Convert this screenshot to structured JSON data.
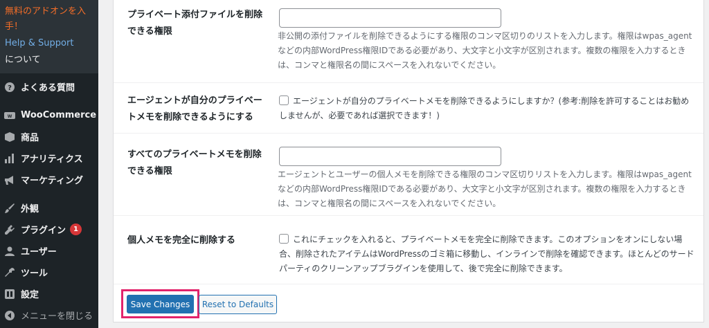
{
  "sidebar": {
    "submenu": {
      "promo": "無料のアドオンを入手！",
      "help": "Help & Support",
      "about": "について"
    },
    "items": [
      {
        "label": "よくある質問",
        "icon": "question-circle-icon"
      },
      {
        "label": "WooCommerce",
        "icon": "woocommerce-icon"
      },
      {
        "label": "商品",
        "icon": "archive-box-icon"
      },
      {
        "label": "アナリティクス",
        "icon": "bar-chart-icon"
      },
      {
        "label": "マーケティング",
        "icon": "megaphone-icon"
      },
      {
        "label": "外観",
        "icon": "paintbrush-icon"
      },
      {
        "label": "プラグイン",
        "icon": "plugin-icon",
        "badge": "1"
      },
      {
        "label": "ユーザー",
        "icon": "user-icon"
      },
      {
        "label": "ツール",
        "icon": "wrench-icon"
      },
      {
        "label": "設定",
        "icon": "settings-icon"
      },
      {
        "label": "メニューを閉じる",
        "icon": "collapse-arrow-icon"
      }
    ]
  },
  "settings": {
    "row1": {
      "label": "プライベート添付ファイルを削除できる権限",
      "description": "非公開の添付ファイルを削除できるようにする権限のコンマ区切りのリストを入力します。権限はwpas_agentなどの内部WordPress権限IDである必要があり、大文字と小文字が区別されます。複数の権限を入力するときは、コンマと権限名の間にスペースを入れないでください。"
    },
    "row2": {
      "label": "エージェントが自分のプライベートメモを削除できるようにする",
      "checkbox_label": "エージェントが自分のプライベートメモを削除できるようにしますか？(参考:削除を許可することはお勧めしませんが、必要であれば選択できます！)"
    },
    "row3": {
      "label": "すべてのプライベートメモを削除できる権限",
      "description": "エージェントとユーザーの個人メモを削除できる権限のコンマ区切りリストを入力します。権限はwpas_agentなどの内部WordPress権限IDである必要があり、大文字と小文字が区別されます。複数の権限を入力するときは、コンマと権限名の間にスペースを入れないでください。"
    },
    "row4": {
      "label": "個人メモを完全に削除する",
      "checkbox_label": "これにチェックを入れると、プライベートメモを完全に削除できます。このオプションをオンにしない場合、削除されたアイテムはWordPressのゴミ箱に移動し、インラインで削除を確認できます。ほとんどのサードパーティのクリーンアップブラグインを使用して、後で完全に削除できます。"
    }
  },
  "buttons": {
    "save": "Save Changes",
    "reset": "Reset to Defaults"
  },
  "colors": {
    "sidebar_bg": "#1d2327",
    "primary": "#2271b1",
    "highlight_frame": "#e2236b",
    "promo": "#f56e28"
  }
}
